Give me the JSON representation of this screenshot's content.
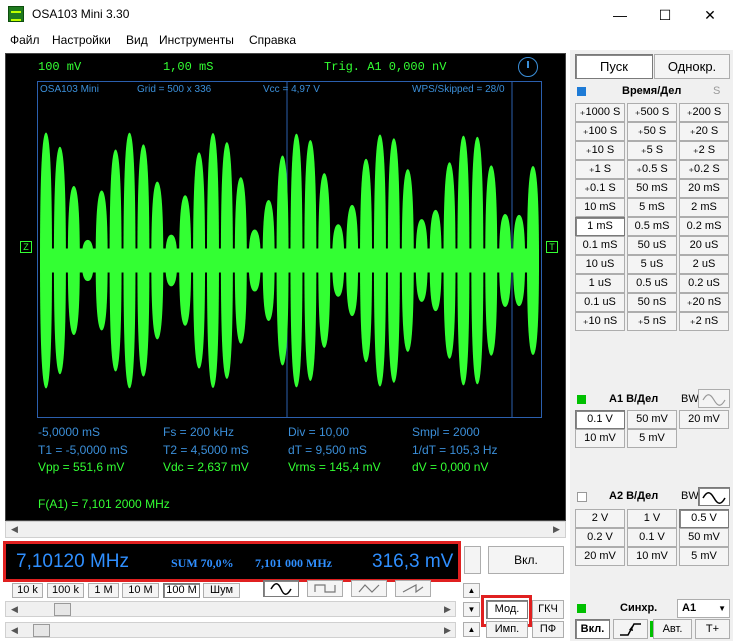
{
  "window": {
    "title": "OSA103 Mini 3.30",
    "minimize": "—",
    "maximize": "☐",
    "close": "✕"
  },
  "menu": [
    "Файл",
    "Настройки",
    "Вид",
    "Инструменты",
    "Справка"
  ],
  "scope": {
    "header": {
      "volts": "100 mV",
      "time": "1,00 mS",
      "trigger": "Trig. A1  0,000 nV"
    },
    "info": {
      "app": "OSA103 Mini",
      "grid": "Grid = 500 x 336",
      "vcc": "Vcc = 4,97 V",
      "wps": "WPS/Skipped = 28/0"
    },
    "stats_white": {
      "r1": [
        "-5,0000 mS",
        "Fs = 200 kHz",
        "Div = 10,00",
        "Smpl = 2000"
      ],
      "r2": [
        "T1 = -5,0000 mS",
        "T2 = 4,5000 mS",
        "dT = 9,500 mS",
        "1/dT = 105,3 Hz"
      ]
    },
    "stats_green": [
      "Vpp = 551,6 mV",
      "Vdc = 2,637 mV",
      "Vrms = 145,4 mV",
      "dV = 0,000 nV"
    ],
    "frequency": "F(A1) = 7,101 2000 MHz",
    "marker_left": "Z",
    "marker_right": "T",
    "waveform": {
      "color": "#33ff33",
      "beats": 13
    }
  },
  "generator": {
    "frequency": "7,10120 MHz",
    "mode": "SUM 70,0%",
    "freq2": "7,101 000 MHz",
    "amplitude": "316,3 mV",
    "on_button": "Вкл.",
    "range_buttons": [
      "10 k",
      "100 k",
      "1 M",
      "10 M",
      "100 M",
      "Шум"
    ],
    "mod_button": "Мод.",
    "gkch_button": "ГКЧ",
    "imp_button": "Имп.",
    "pf_button": "ПФ"
  },
  "controls": {
    "start": "Пуск",
    "single": "Однокр.",
    "timediv_title": "Время/Дел",
    "timediv_s": "S",
    "timediv": [
      [
        "₊1000 S",
        "₊500 S",
        "₊200 S"
      ],
      [
        "₊100 S",
        "₊50 S",
        "₊20 S"
      ],
      [
        "₊10 S",
        "₊5 S",
        "₊2 S"
      ],
      [
        "₊1 S",
        "₊0.5 S",
        "₊0.2 S"
      ],
      [
        "₊0.1 S",
        "50 mS",
        "20 mS"
      ],
      [
        "10 mS",
        "5 mS",
        "2 mS"
      ],
      [
        "1 mS",
        "0.5 mS",
        "0.2 mS"
      ],
      [
        "0.1 mS",
        "50 uS",
        "20 uS"
      ],
      [
        "10 uS",
        "5 uS",
        "2 uS"
      ],
      [
        "1 uS",
        "0.5 uS",
        "0.2 uS"
      ],
      [
        "0.1 uS",
        "50 nS",
        "₊20 nS"
      ],
      [
        "₊10 nS",
        "₊5 nS",
        "₊2 nS"
      ]
    ],
    "a1_title": "A1 В/Дел",
    "a1_bw": "BW",
    "a1_volts": [
      [
        "0.1 V",
        "50 mV",
        "20 mV"
      ],
      [
        "10 mV",
        "5 mV"
      ]
    ],
    "a2_title": "A2 В/Дел",
    "a2_bw": "BW",
    "a2_volts": [
      [
        "2 V",
        "1 V",
        "0.5 V"
      ],
      [
        "0.2 V",
        "0.1 V",
        "50 mV"
      ],
      [
        "20 mV",
        "10 mV",
        "5 mV"
      ]
    ],
    "sync_title": "Синхр.",
    "sync_channel": "A1",
    "sync_on": "Вкл.",
    "sync_auto": "Авт.",
    "sync_tplus": "T+",
    "colors": {
      "a1": "#00c000",
      "timediv": "#1e7bd6"
    }
  }
}
